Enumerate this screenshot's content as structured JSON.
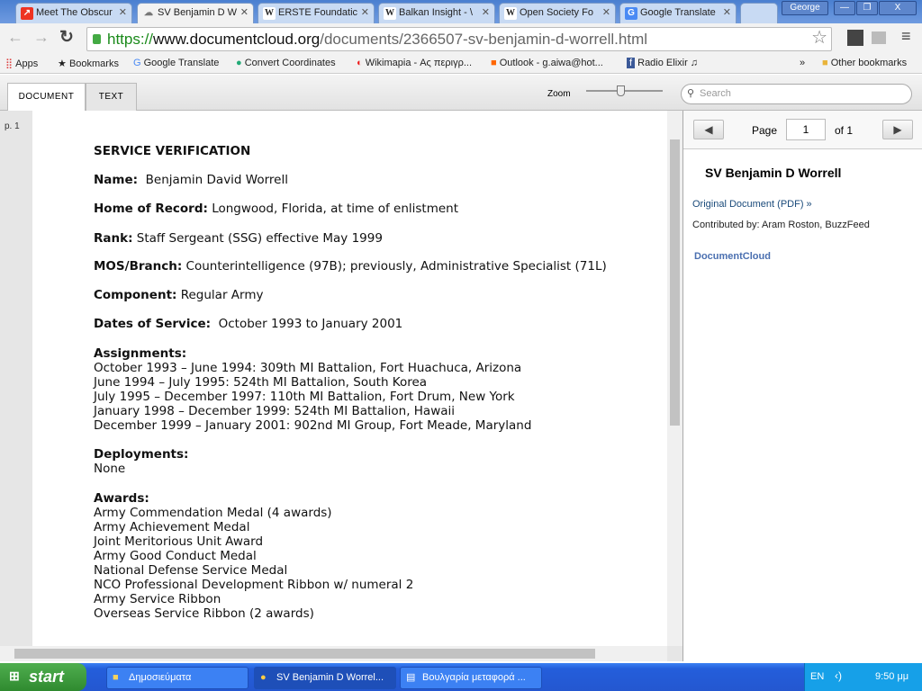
{
  "browser": {
    "tabs": [
      {
        "title": "Meet The Obscur",
        "icon": "buzzfeed-icon"
      },
      {
        "title": "SV Benjamin D W",
        "icon": "cloud-icon",
        "active": true
      },
      {
        "title": "ERSTE Foundatic",
        "icon": "wikipedia-icon"
      },
      {
        "title": "Balkan Insight - \\",
        "icon": "wikipedia-icon"
      },
      {
        "title": "Open Society Fo",
        "icon": "wikipedia-icon"
      },
      {
        "title": "Google Translate",
        "icon": "google-translate-icon"
      }
    ],
    "user": "George",
    "url_scheme": "https://",
    "url_host": "www.documentcloud.org",
    "url_path": "/documents/2366507-sv-benjamin-d-worrell.html",
    "bookmarks": [
      "Apps",
      "Bookmarks",
      "Google Translate",
      "Convert Coordinates",
      "Wikimapia - Ας περιγρ...",
      "Outlook - g.aiwa@hot...",
      "Radio Elixir ♫"
    ],
    "overflow": "»",
    "other_bookmarks": "Other bookmarks"
  },
  "viewer": {
    "tab_document": "DOCUMENT",
    "tab_text": "TEXT",
    "zoom_label": "Zoom",
    "zoom_level": 0.45,
    "search_placeholder": "Search",
    "page_label": "p. 1",
    "page_word": "Page",
    "page_value": "1",
    "of_label": "of 1",
    "doc_title": "SV Benjamin D Worrell",
    "original_link": "Original Document (PDF) »",
    "contributed": "Contributed by:  Aram Roston, BuzzFeed",
    "logo": "DocumentCloud"
  },
  "document": {
    "heading": "SERVICE VERIFICATION",
    "name_label": "Name:",
    "name": "Benjamin David Worrell",
    "home_label": "Home of Record:",
    "home": "Longwood, Florida, at time of enlistment",
    "rank_label": "Rank:",
    "rank": "Staff Sergeant (SSG) effective May 1999",
    "mos_label": "MOS/Branch:",
    "mos": "Counterintelligence (97B); previously, Administrative Specialist (71L)",
    "component_label": "Component:",
    "component": "Regular Army",
    "dates_label": "Dates of Service:",
    "dates": "October 1993 to January 2001",
    "assignments_label": "Assignments:",
    "assignments": [
      "October 1993 – June 1994: 309th MI Battalion, Fort Huachuca, Arizona",
      "June 1994 – July 1995: 524th MI Battalion, South Korea",
      "July 1995 – December 1997: 110th MI Battalion, Fort Drum, New York",
      "January 1998 – December 1999: 524th MI Battalion, Hawaii",
      "December 1999 – January 2001: 902nd MI Group, Fort Meade, Maryland"
    ],
    "deployments_label": "Deployments:",
    "deployments": "None",
    "awards_label": "Awards:",
    "awards": [
      "Army Commendation Medal (4 awards)",
      "Army Achievement Medal",
      "Joint Meritorious Unit Award",
      "Army Good Conduct Medal",
      "National Defense Service Medal",
      "NCO Professional Development Ribbon w/ numeral 2",
      "Army Service Ribbon",
      "Overseas Service Ribbon (2 awards)"
    ]
  },
  "taskbar": {
    "start": "start",
    "items": [
      "Δημοσιεύματα",
      "SV Benjamin D Worrel...",
      "Βουλγαρία μεταφορά ..."
    ],
    "lang": "EN",
    "time": "9:50 μμ"
  }
}
